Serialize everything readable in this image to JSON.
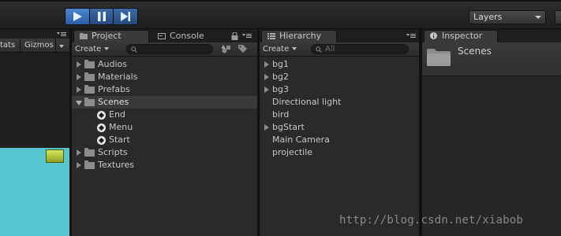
{
  "toolbar": {
    "layers_label": "Layers"
  },
  "scene": {
    "stats_label": "tats",
    "gizmos_label": "Gizmos",
    "viewport_color": "#55c6d0",
    "sprite_color": "#b7cc3a"
  },
  "project": {
    "tab_label": "Project",
    "console_tab_label": "Console",
    "create_label": "Create",
    "folders": [
      {
        "label": "Audios"
      },
      {
        "label": "Materials"
      },
      {
        "label": "Prefabs"
      },
      {
        "label": "Scenes",
        "expanded": true,
        "selected": true
      },
      {
        "label": "Scripts"
      },
      {
        "label": "Textures"
      }
    ],
    "scenes": [
      {
        "label": "End"
      },
      {
        "label": "Menu"
      },
      {
        "label": "Start"
      }
    ]
  },
  "hierarchy": {
    "tab_label": "Hierarchy",
    "create_label": "Create",
    "search_placeholder": "All",
    "items": [
      {
        "label": "bg1",
        "has_children": true
      },
      {
        "label": "bg2",
        "has_children": true
      },
      {
        "label": "bg3",
        "has_children": true
      },
      {
        "label": "Directional light",
        "has_children": false
      },
      {
        "label": "bird",
        "has_children": false
      },
      {
        "label": "bgStart",
        "has_children": true
      },
      {
        "label": "Main Camera",
        "has_children": false
      },
      {
        "label": "projectile",
        "has_children": false
      }
    ]
  },
  "inspector": {
    "tab_label": "Inspector",
    "object_name": "Scenes"
  },
  "watermark": "http://blog.csdn.net/xiabob"
}
